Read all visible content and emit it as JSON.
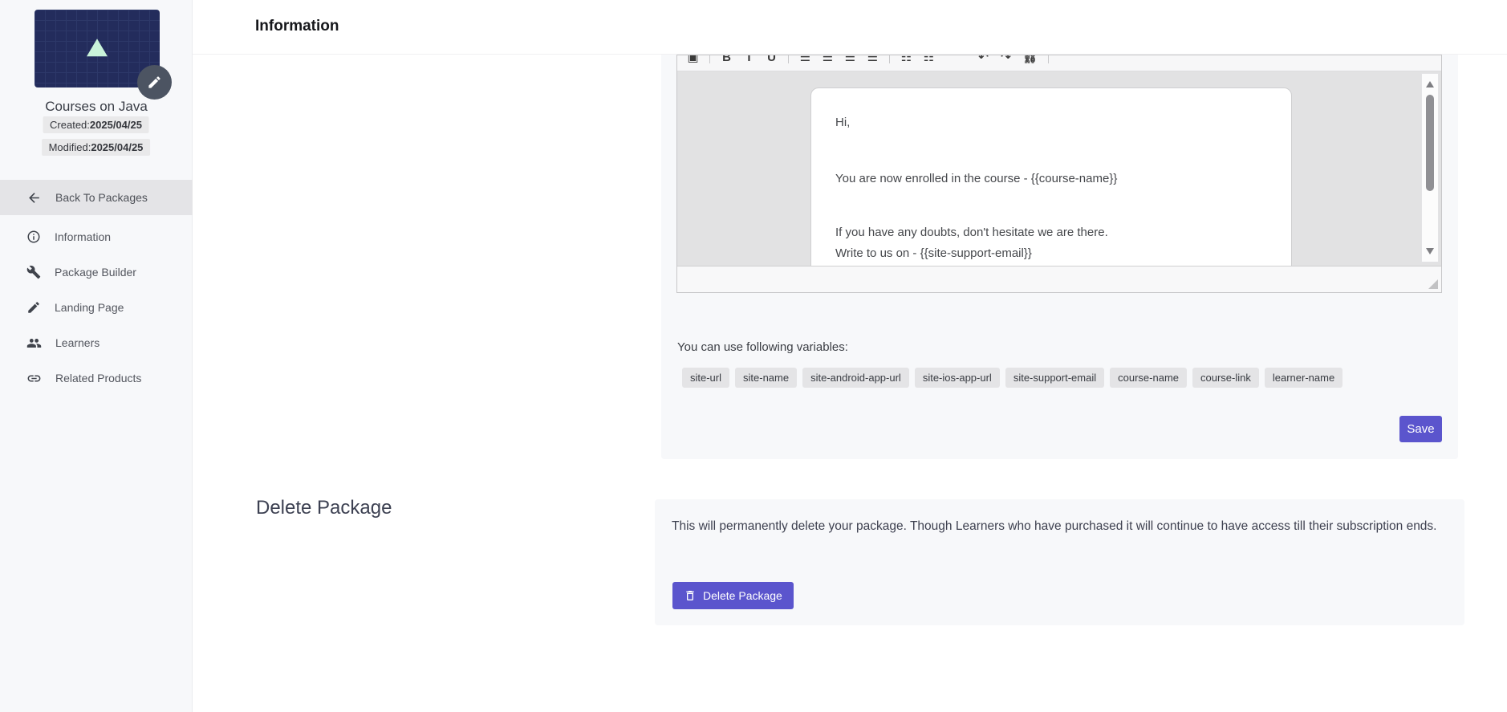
{
  "sidebar": {
    "course_title": "Courses on Java",
    "created_label": "Created:",
    "created_date": "2025/04/25",
    "modified_label": "Modified:",
    "modified_date": "2025/04/25",
    "back_label": "Back To Packages",
    "items": [
      {
        "label": "Information",
        "icon": "info-icon"
      },
      {
        "label": "Package Builder",
        "icon": "wrench-icon"
      },
      {
        "label": "Landing Page",
        "icon": "brush-icon"
      },
      {
        "label": "Learners",
        "icon": "people-icon"
      },
      {
        "label": "Related Products",
        "icon": "link-icon"
      }
    ]
  },
  "header": {
    "title": "Information"
  },
  "email_editor": {
    "toolbar_icons": [
      {
        "name": "image",
        "glyph": "▣"
      },
      {
        "name": "bold",
        "glyph": "B"
      },
      {
        "name": "italic",
        "glyph": "I"
      },
      {
        "name": "underline",
        "glyph": "U"
      },
      {
        "name": "align-left",
        "glyph": "☰"
      },
      {
        "name": "align-center",
        "glyph": "☰"
      },
      {
        "name": "align-right",
        "glyph": "☰"
      },
      {
        "name": "align-justify",
        "glyph": "☰"
      },
      {
        "name": "list-bulleted",
        "glyph": "☷"
      },
      {
        "name": "list-numbered",
        "glyph": "☷"
      },
      {
        "name": "undo",
        "glyph": "↶"
      },
      {
        "name": "redo",
        "glyph": "↷"
      },
      {
        "name": "link",
        "glyph": "⛓"
      }
    ],
    "lines": [
      "Hi,",
      "You are now enrolled in the course - {{course-name}}",
      "If you have any doubts, don't hesitate we are there.",
      "Write to us on - {{site-support-email}}"
    ],
    "variables_label": "You can use following variables:",
    "variables": [
      "site-url",
      "site-name",
      "site-android-app-url",
      "site-ios-app-url",
      "site-support-email",
      "course-name",
      "course-link",
      "learner-name"
    ],
    "save_label": "Save"
  },
  "delete_section": {
    "title": "Delete Package",
    "description": "This will permanently delete your package. Though Learners who have purchased it will continue to have access till their subscription ends.",
    "button_label": "Delete Package"
  },
  "colors": {
    "accent": "#5b55cd",
    "sidebar_bg": "#f7f8fa",
    "card_bg": "#f7f8fa",
    "thumbnail_bg": "#232c5c",
    "thumbnail_triangle": "#c9f3da",
    "editor_canvas_bg": "#e2e2e3"
  }
}
